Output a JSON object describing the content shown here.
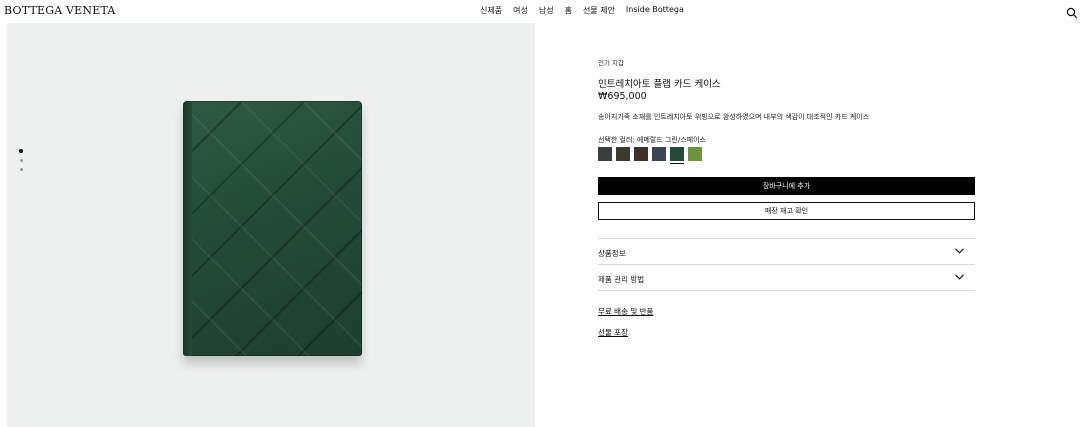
{
  "header": {
    "logo": "BOTTEGA VENETA",
    "nav": [
      "신제품",
      "여성",
      "남성",
      "홈",
      "선물 제안",
      "Inside Bottega"
    ],
    "search_icon": "search-icon"
  },
  "gallery": {
    "dots": 3,
    "active_dot": 1,
    "image_alt": "green intrecciato flap card case"
  },
  "product": {
    "breadcrumb": "인기 지갑",
    "title": "인트레치아토 플랩 카드 케이스",
    "price": "₩695,000",
    "description": "송아지가죽 소재를 인트레치아토 위빙으로 완성하였으며 내부의 색감이 대조적인 카드 케이스",
    "color_label": "선택한 컬러: 에메랄드 그린/스페이스",
    "swatches": [
      {
        "color": "#3a3f3b"
      },
      {
        "color": "#3b3a2e"
      },
      {
        "color": "#3e3228"
      },
      {
        "color": "#3d4457"
      },
      {
        "color": "#234b3c",
        "selected": true
      },
      {
        "color": "#6f9440"
      }
    ],
    "add_to_cart": "장바구니에 추가",
    "store_check": "매장 재고 확인",
    "accordion": [
      "상품정보",
      "제품 관리 방법"
    ],
    "links": [
      "무료 배송 및 반품",
      "선물 포장"
    ]
  }
}
